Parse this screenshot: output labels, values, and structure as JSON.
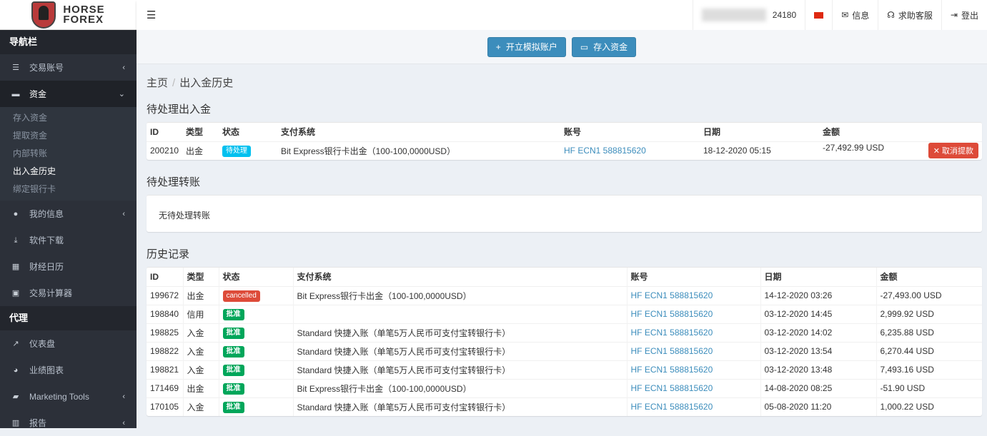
{
  "logo": {
    "line1": "HORSE",
    "line2": "FOREX"
  },
  "sidebar": {
    "header1": "导航栏",
    "items": [
      {
        "label": "交易账号",
        "icon": "list-icon",
        "chev": "‹"
      },
      {
        "label": "资金",
        "icon": "wallet-icon",
        "chev": "⌄"
      }
    ],
    "sub": [
      "存入资金",
      "提取资金",
      "内部转账",
      "出入金历史",
      "绑定银行卡"
    ],
    "items2": [
      {
        "label": "我的信息",
        "icon": "user-icon",
        "chev": "‹"
      },
      {
        "label": "软件下载",
        "icon": "download-icon"
      },
      {
        "label": "财经日历",
        "icon": "calendar-icon"
      },
      {
        "label": "交易计算器",
        "icon": "calculator-icon"
      }
    ],
    "header2": "代理",
    "items3": [
      {
        "label": "仪表盘",
        "icon": "line-chart-icon"
      },
      {
        "label": "业绩图表",
        "icon": "pie-chart-icon"
      },
      {
        "label": "Marketing Tools",
        "icon": "briefcase-icon",
        "chev": "‹"
      },
      {
        "label": "报告",
        "icon": "bar-chart-icon",
        "chev": "‹"
      }
    ]
  },
  "topbar": {
    "account": "24180",
    "messages": "信息",
    "support": "求助客服",
    "logout": "登出"
  },
  "actions": {
    "demo": "开立模拟账户",
    "deposit": "存入资金"
  },
  "breadcrumb": {
    "home": "主页",
    "current": "出入金历史"
  },
  "pending": {
    "title": "待处理出入金",
    "headers": [
      "ID",
      "类型",
      "状态",
      "支付系统",
      "账号",
      "日期",
      "金额"
    ],
    "rows": [
      {
        "id": "200210",
        "type": "出金",
        "status": "待处理",
        "system": "Bit Express银行卡出金（100-100,0000USD）",
        "account": "HF ECN1 588815620",
        "date": "18-12-2020 05:15",
        "amount": "-27,492.99 USD",
        "action": "取消提款"
      }
    ]
  },
  "transfers": {
    "title": "待处理转账",
    "empty": "无待处理转账"
  },
  "history": {
    "title": "历史记录",
    "headers": [
      "ID",
      "类型",
      "状态",
      "支付系统",
      "账号",
      "日期",
      "金额"
    ],
    "rows": [
      {
        "id": "199672",
        "type": "出金",
        "status": "cancelled",
        "status_color": "#dd4b39",
        "system": "Bit Express银行卡出金（100-100,0000USD）",
        "account": "HF ECN1 588815620",
        "date": "14-12-2020 03:26",
        "amount": "-27,493.00 USD"
      },
      {
        "id": "198840",
        "type": "信用",
        "status": "批准",
        "status_color": "#00a65a",
        "system": "",
        "account": "HF ECN1 588815620",
        "date": "03-12-2020 14:45",
        "amount": "2,999.92 USD"
      },
      {
        "id": "198825",
        "type": "入金",
        "status": "批准",
        "status_color": "#00a65a",
        "system": "Standard 快捷入账（单笔5万人民币可支付宝转银行卡）",
        "account": "HF ECN1 588815620",
        "date": "03-12-2020 14:02",
        "amount": "6,235.88 USD"
      },
      {
        "id": "198822",
        "type": "入金",
        "status": "批准",
        "status_color": "#00a65a",
        "system": "Standard 快捷入账（单笔5万人民币可支付宝转银行卡）",
        "account": "HF ECN1 588815620",
        "date": "03-12-2020 13:54",
        "amount": "6,270.44 USD"
      },
      {
        "id": "198821",
        "type": "入金",
        "status": "批准",
        "status_color": "#00a65a",
        "system": "Standard 快捷入账（单笔5万人民币可支付宝转银行卡）",
        "account": "HF ECN1 588815620",
        "date": "03-12-2020 13:48",
        "amount": "7,493.16 USD"
      },
      {
        "id": "171469",
        "type": "出金",
        "status": "批准",
        "status_color": "#00a65a",
        "system": "Bit Express银行卡出金（100-100,0000USD）",
        "account": "HF ECN1 588815620",
        "date": "14-08-2020 08:25",
        "amount": "-51.90 USD"
      },
      {
        "id": "170105",
        "type": "入金",
        "status": "批准",
        "status_color": "#00a65a",
        "system": "Standard 快捷入账（单笔5万人民币可支付宝转银行卡）",
        "account": "HF ECN1 588815620",
        "date": "05-08-2020 11:20",
        "amount": "1,000.22 USD"
      }
    ]
  }
}
